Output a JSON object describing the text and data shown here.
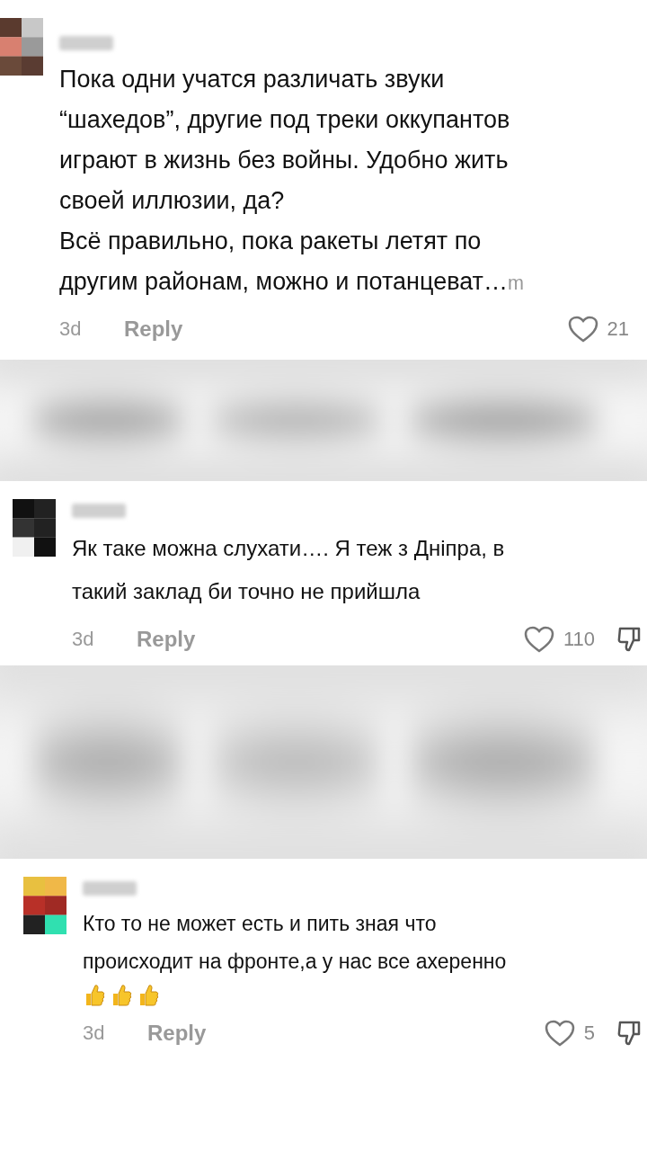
{
  "comments": [
    {
      "lines": [
        "Пока одни учатся различать звуки",
        "“шахедов”, другие под треки оккупантов",
        "играют в жизнь без войны. Удобно жить",
        "своей иллюзии, да?",
        "Всё правильно, пока ракеты летят по",
        "другим районам, можно и потанцеват…"
      ],
      "more": "m",
      "time": "3d",
      "reply": "Reply",
      "likes": "21",
      "dislike_shown": false
    },
    {
      "lines": [
        "Як таке можна слухати…. Я теж з Дніпра, в",
        "такий заклад би точно не прийшла"
      ],
      "time": "3d",
      "reply": "Reply",
      "likes": "110",
      "dislike_shown": true
    },
    {
      "lines": [
        "Кто то не может есть и пить зная что",
        "происходит на фронте,а у нас все ахеренно"
      ],
      "time": "3d",
      "reply": "Reply",
      "likes": "5",
      "dislike_shown": true,
      "emojis": [
        {
          "kind": "thumbs_up"
        },
        {
          "kind": "thumbs_up"
        },
        {
          "kind": "thumbs_up"
        }
      ]
    }
  ]
}
